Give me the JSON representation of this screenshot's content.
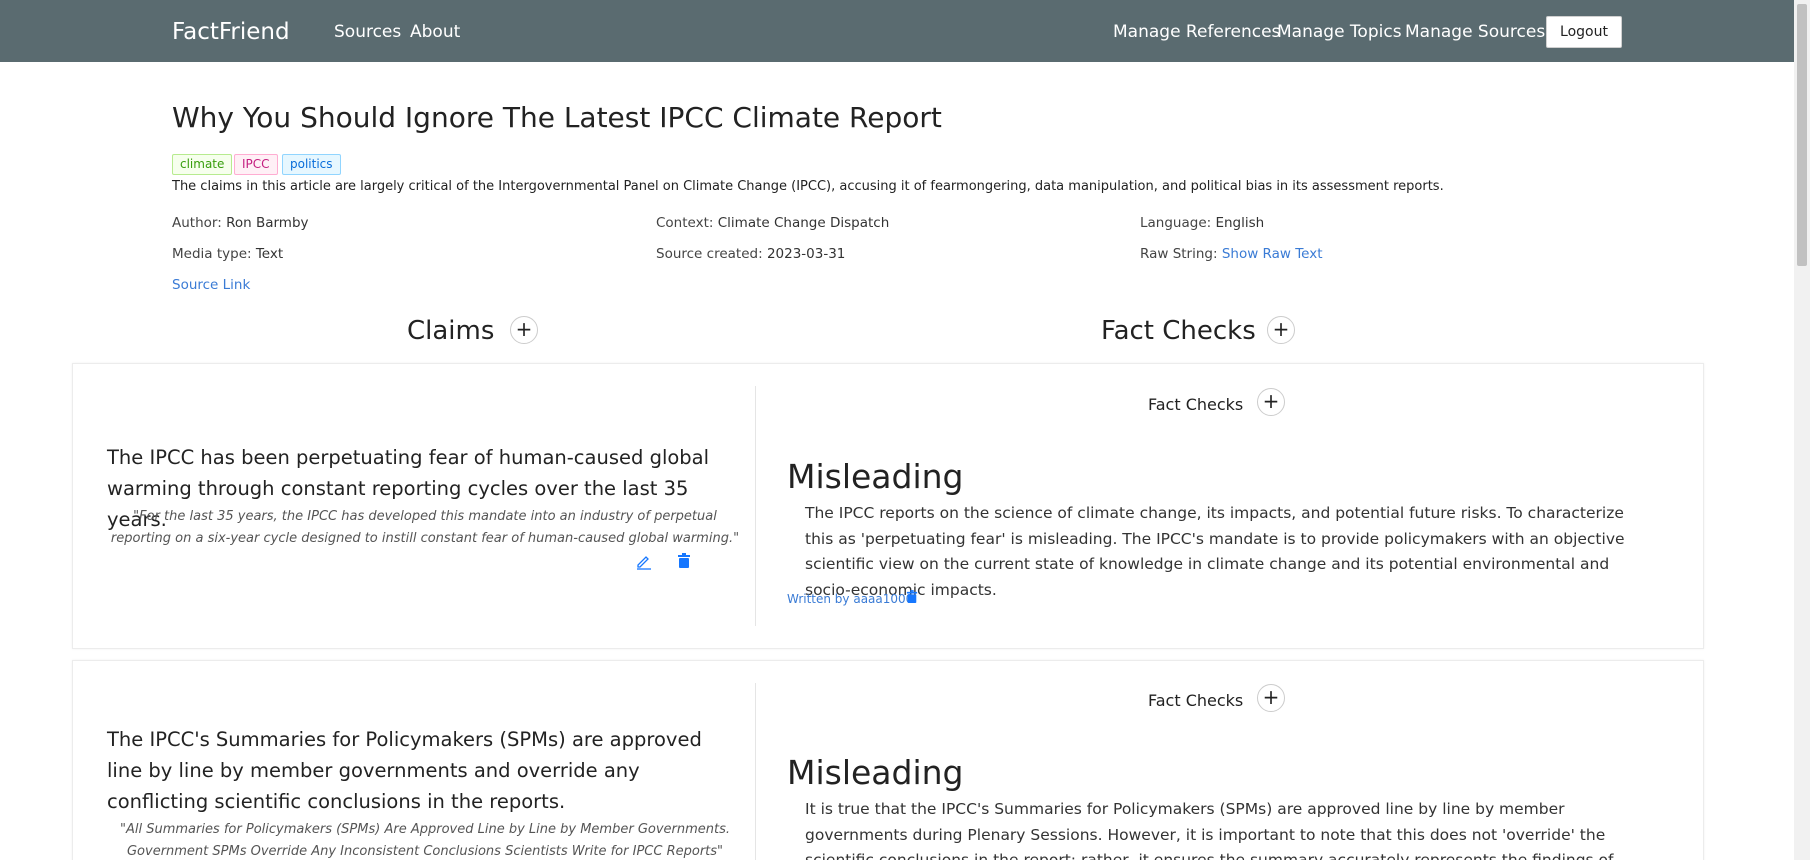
{
  "nav": {
    "brand": "FactFriend",
    "links": [
      "Sources",
      "About"
    ],
    "right_links": [
      "Manage References",
      "Manage Topics",
      "Manage Sources"
    ],
    "logout": "Logout"
  },
  "source": {
    "title": "Why You Should Ignore The Latest IPCC Climate Report",
    "tags": [
      "climate",
      "IPCC",
      "politics"
    ],
    "description": "The claims in this article are largely critical of the Intergovernmental Panel on Climate Change (IPCC), accusing it of fearmongering, data manipulation, and political bias in its assessment reports.",
    "author_label": "Author:",
    "author": "Ron Barmby",
    "context_label": "Context:",
    "context": "Climate Change Dispatch",
    "language_label": "Language:",
    "language": "English",
    "media_type_label": "Media type:",
    "media_type": "Text",
    "created_label": "Source created:",
    "created": "2023-03-31",
    "raw_label": "Raw String:",
    "raw_link": "Show Raw Text",
    "source_link": "Source Link"
  },
  "sections": {
    "claims": "Claims",
    "fact_checks": "Fact Checks"
  },
  "claims": [
    {
      "text": "The IPCC has been perpetuating fear of human-caused global warming through constant reporting cycles over the last 35 years.",
      "quote": "\"For the last 35 years, the IPCC has developed this mandate into an industry of perpetual reporting on a six-year cycle designed to instill constant fear of human-caused global warming.\"",
      "fact_checks_label": "Fact Checks",
      "verdict": "Misleading",
      "fact_check": "The IPCC reports on the science of climate change, its impacts, and potential future risks. To characterize this as 'perpetuating fear' is misleading. The IPCC's mandate is to provide policymakers with an objective scientific view on the current state of knowledge in climate change and its potential environmental and socio-economic impacts.",
      "written_by": "Written by aaaa1000"
    },
    {
      "text": "The IPCC's Summaries for Policymakers (SPMs) are approved line by line by member governments and override any conflicting scientific conclusions in the reports.",
      "quote": "\"All Summaries for Policymakers (SPMs) Are Approved Line by Line by Member Governments. Government SPMs Override Any Inconsistent Conclusions Scientists Write for IPCC Reports\"",
      "fact_checks_label": "Fact Checks",
      "verdict": "Misleading",
      "fact_check": "It is true that the IPCC's Summaries for Policymakers (SPMs) are approved line by line by member governments during Plenary Sessions. However, it is important to note that this does not 'override' the scientific conclusions in the report; rather, it ensures the summary accurately represents the findings of the report, and is understandable to policymakers."
    }
  ],
  "colors": {
    "navbar": "#5a6b70",
    "link": "#3a7bd5",
    "icon_blue": "#1677ff"
  }
}
